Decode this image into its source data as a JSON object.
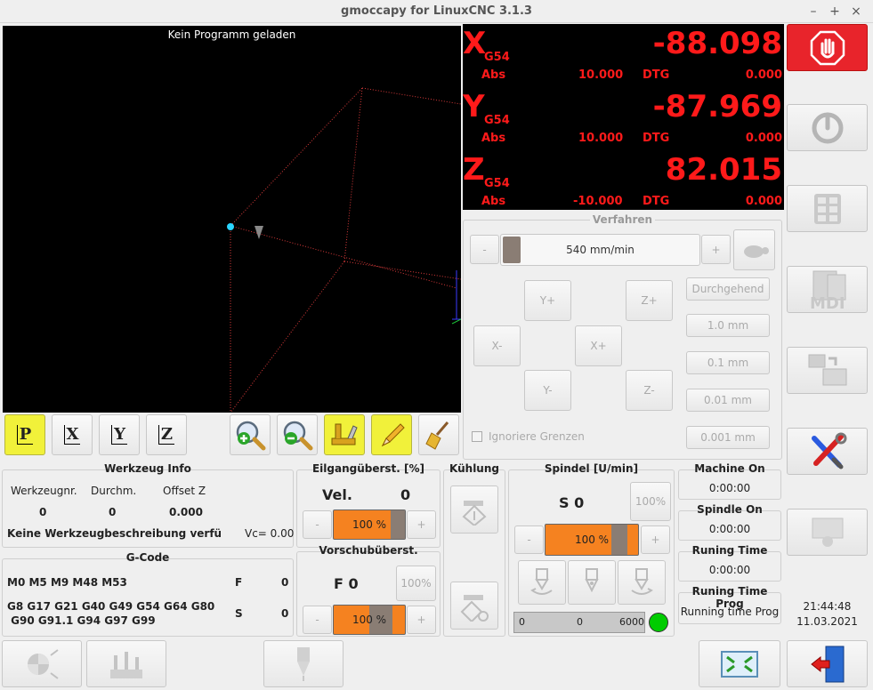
{
  "window": {
    "title": "gmoccapy for LinuxCNC  3.1.3",
    "min": "–",
    "max": "+",
    "close": "×"
  },
  "preview": {
    "message": "Kein Programm geladen"
  },
  "dro": {
    "x": {
      "letter": "X",
      "sys": "G54",
      "value": "-88.098",
      "abs_label": "Abs",
      "abs": "10.000",
      "dtg_label": "DTG",
      "dtg": "0.000"
    },
    "y": {
      "letter": "Y",
      "sys": "G54",
      "value": "-87.969",
      "abs_label": "Abs",
      "abs": "10.000",
      "dtg_label": "DTG",
      "dtg": "0.000"
    },
    "z": {
      "letter": "Z",
      "sys": "G54",
      "value": "82.015",
      "abs_label": "Abs",
      "abs": "-10.000",
      "dtg_label": "DTG",
      "dtg": "0.000"
    }
  },
  "jog": {
    "title": "Verfahren",
    "minus": "-",
    "plus": "+",
    "speed": "540 mm/min",
    "yplus": "Y+",
    "zplus": "Z+",
    "xminus": "X-",
    "xplus": "X+",
    "yminus": "Y-",
    "zminus": "Z-",
    "increments": [
      "Durchgehend",
      "1.0 mm",
      "0.1 mm",
      "0.01 mm",
      "0.001 mm"
    ],
    "ignore_limits": "Ignoriere Grenzen"
  },
  "view_buttons": {
    "p": "P",
    "x": "X",
    "y": "Y",
    "z": "Z"
  },
  "tool_info": {
    "title": "Werkzeug Info",
    "col_nr": "Werkzeugnr.",
    "col_diam": "Durchm.",
    "col_offset": "Offset Z",
    "nr": "0",
    "diam": "0",
    "offset": "0.000",
    "description": "Keine Werkzeugbeschreibung verfügba",
    "vc": "Vc= 0.00"
  },
  "gcode": {
    "title": "G-Code",
    "mcodes": "M0 M5 M9 M48 M53",
    "f_label": "F",
    "f_value": "0",
    "gcodes_line1": "G8 G17 G21 G40 G49 G54 G64 G80",
    "gcodes_line2": " G90 G91.1 G94 G97 G99",
    "s_label": "S",
    "s_value": "0"
  },
  "rapid": {
    "title": "Eilgangüberst. [%]",
    "label": "Vel.",
    "value": "0",
    "minus": "-",
    "plus": "+",
    "percent": "100 %",
    "percent_value": 100
  },
  "feed": {
    "title": "Vorschubüberst.",
    "label": "F  0",
    "reset": "100%",
    "minus": "-",
    "plus": "+",
    "percent": "100 %",
    "percent_value": 100
  },
  "coolant": {
    "title": "Kühlung"
  },
  "spindle": {
    "title": "Spindel [U/min]",
    "speed": "S 0",
    "reset": "100%",
    "minus": "-",
    "plus": "+",
    "percent": "100 %",
    "percent_value": 100,
    "bar_min": "0",
    "bar_mid": "0",
    "bar_max": "6000",
    "led_color": "#00cc00"
  },
  "timers": {
    "machine_on_label": "Machine On",
    "machine_on": "0:00:00",
    "spindle_on_label": "Spindle On",
    "spindle_on": "0:00:00",
    "runing_time_label": "Runing Time",
    "runing_time": "0:00:00",
    "runing_prog_label": "Runing Time Prog",
    "runing_prog": "Running time Prog"
  },
  "clock": {
    "time": "21:44:48",
    "date": "11.03.2021"
  },
  "colors": {
    "dro_text": "#ff1a1a",
    "estop": "#e8242b",
    "highlight": "#f1f13a",
    "orange": "#f58220"
  }
}
